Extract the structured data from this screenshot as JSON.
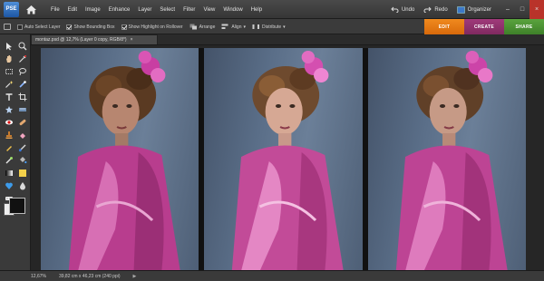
{
  "app": {
    "logo_text": "PSE"
  },
  "menubar": {
    "items": [
      "File",
      "Edit",
      "Image",
      "Enhance",
      "Layer",
      "Select",
      "Filter",
      "View",
      "Window",
      "Help"
    ],
    "undo_label": "Undo",
    "redo_label": "Redo",
    "organizer_label": "Organizer"
  },
  "options": {
    "auto_select_label": "Auto Select Layer",
    "show_bounding_box_label": "Show Bounding Box",
    "show_highlight_label": "Show Highlight on Rollover",
    "arrange_label": "Arrange",
    "align_label": "Align",
    "distribute_label": "Distribute"
  },
  "mode_tabs": {
    "edit": "EDIT",
    "create": "CREATE",
    "share": "SHARE"
  },
  "document": {
    "tab_title": "montaz.psd @ 12,7% (Layer 0 copy, RGB/8*)",
    "close_glyph": "×"
  },
  "status": {
    "zoom": "12,67%",
    "dimensions": "39,82 cm x 46,23 cm (240 ppi)",
    "arrow_glyph": "▶"
  },
  "colors": {
    "edit_tab": "#e67a14",
    "create_tab": "#8f3270",
    "share_tab": "#4c9235",
    "foreground": "#111111",
    "background": "#eeeeee"
  }
}
